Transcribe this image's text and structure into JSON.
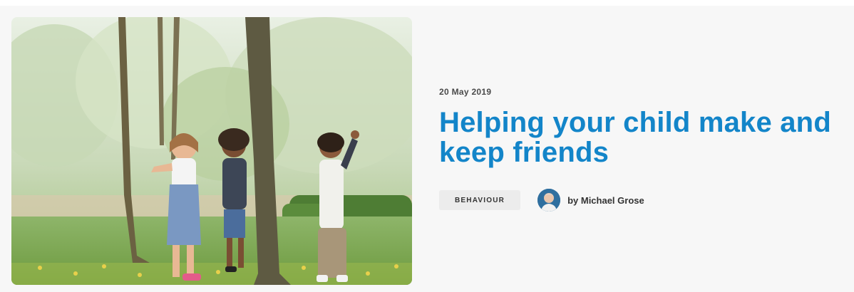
{
  "article": {
    "date": "20 May 2019",
    "title": "Helping your child make and keep friends",
    "category": "BEHAVIOUR",
    "author": "by Michael Grose",
    "image_icon": "photo-children-playing-in-park",
    "avatar_icon": "author-portrait"
  },
  "colors": {
    "title": "#1385c9",
    "tag_bg": "#ececec",
    "card_bg": "#f7f7f7"
  }
}
